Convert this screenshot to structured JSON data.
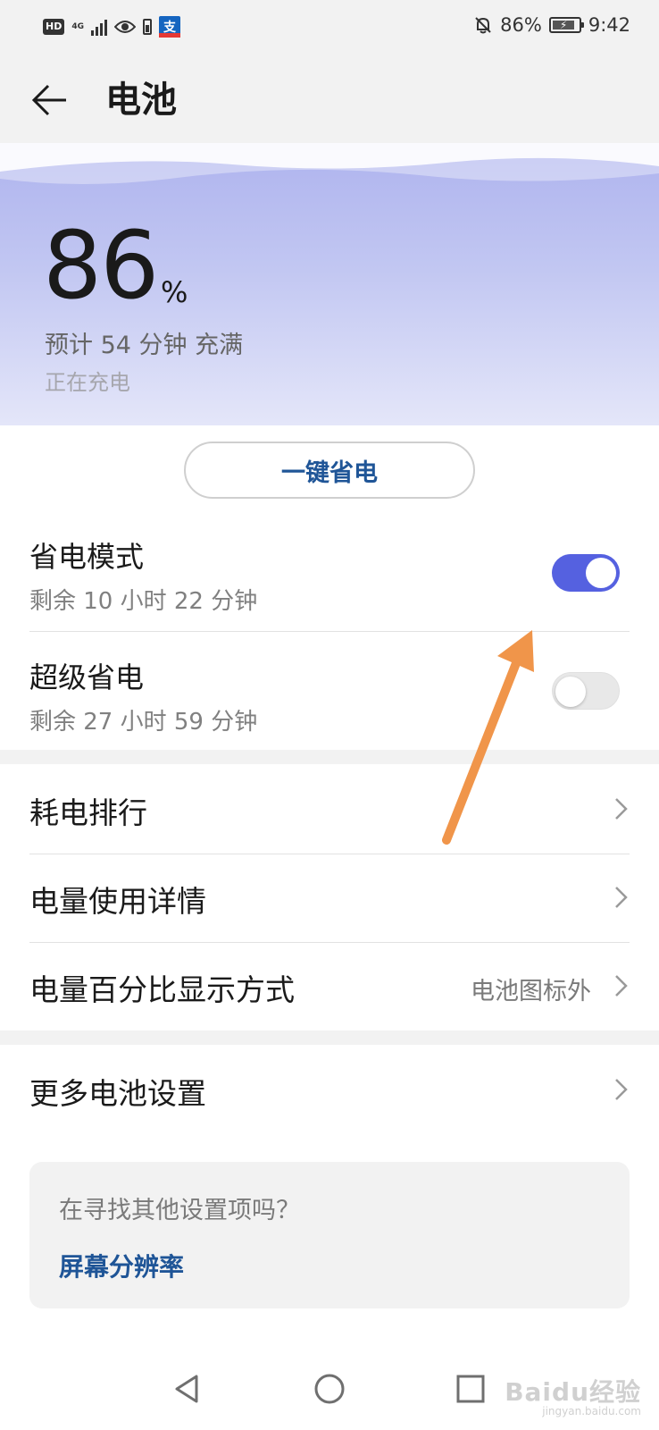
{
  "status_bar": {
    "hd": "HD",
    "network": "4G",
    "app_icon_char": "支",
    "battery_text": "86%",
    "battery_level": 0.86,
    "time": "9:42"
  },
  "header": {
    "title": "电池"
  },
  "battery": {
    "percent": "86",
    "percent_sign": "%",
    "estimate": "预计 54 分钟 充满",
    "status": "正在充电"
  },
  "one_click_button": "一键省电",
  "modes": [
    {
      "title": "省电模式",
      "subtitle": "剩余 10 小时 22 分钟",
      "enabled": true
    },
    {
      "title": "超级省电",
      "subtitle": "剩余 27 小时 59 分钟",
      "enabled": false
    }
  ],
  "menu": [
    {
      "label": "耗电排行",
      "value": ""
    },
    {
      "label": "电量使用详情",
      "value": ""
    },
    {
      "label": "电量百分比显示方式",
      "value": "电池图标外"
    },
    {
      "label": "更多电池设置",
      "value": ""
    }
  ],
  "suggestion_card": {
    "question": "在寻找其他设置项吗？",
    "link": "屏幕分辨率"
  },
  "watermark": {
    "brand": "Baidu经验",
    "site": "jingyan.baidu.com"
  },
  "colors": {
    "accent": "#5561e0",
    "link": "#1f5597",
    "hero_top": "#aeb3ee",
    "hero_bottom": "#e4e6f9",
    "annotation_arrow": "#f0954a"
  },
  "icons": [
    "back-arrow-icon",
    "chevron-right-icon",
    "nav-back-icon",
    "nav-home-icon",
    "nav-recents-icon",
    "eye-icon",
    "bell-off-icon",
    "battery-icon"
  ]
}
